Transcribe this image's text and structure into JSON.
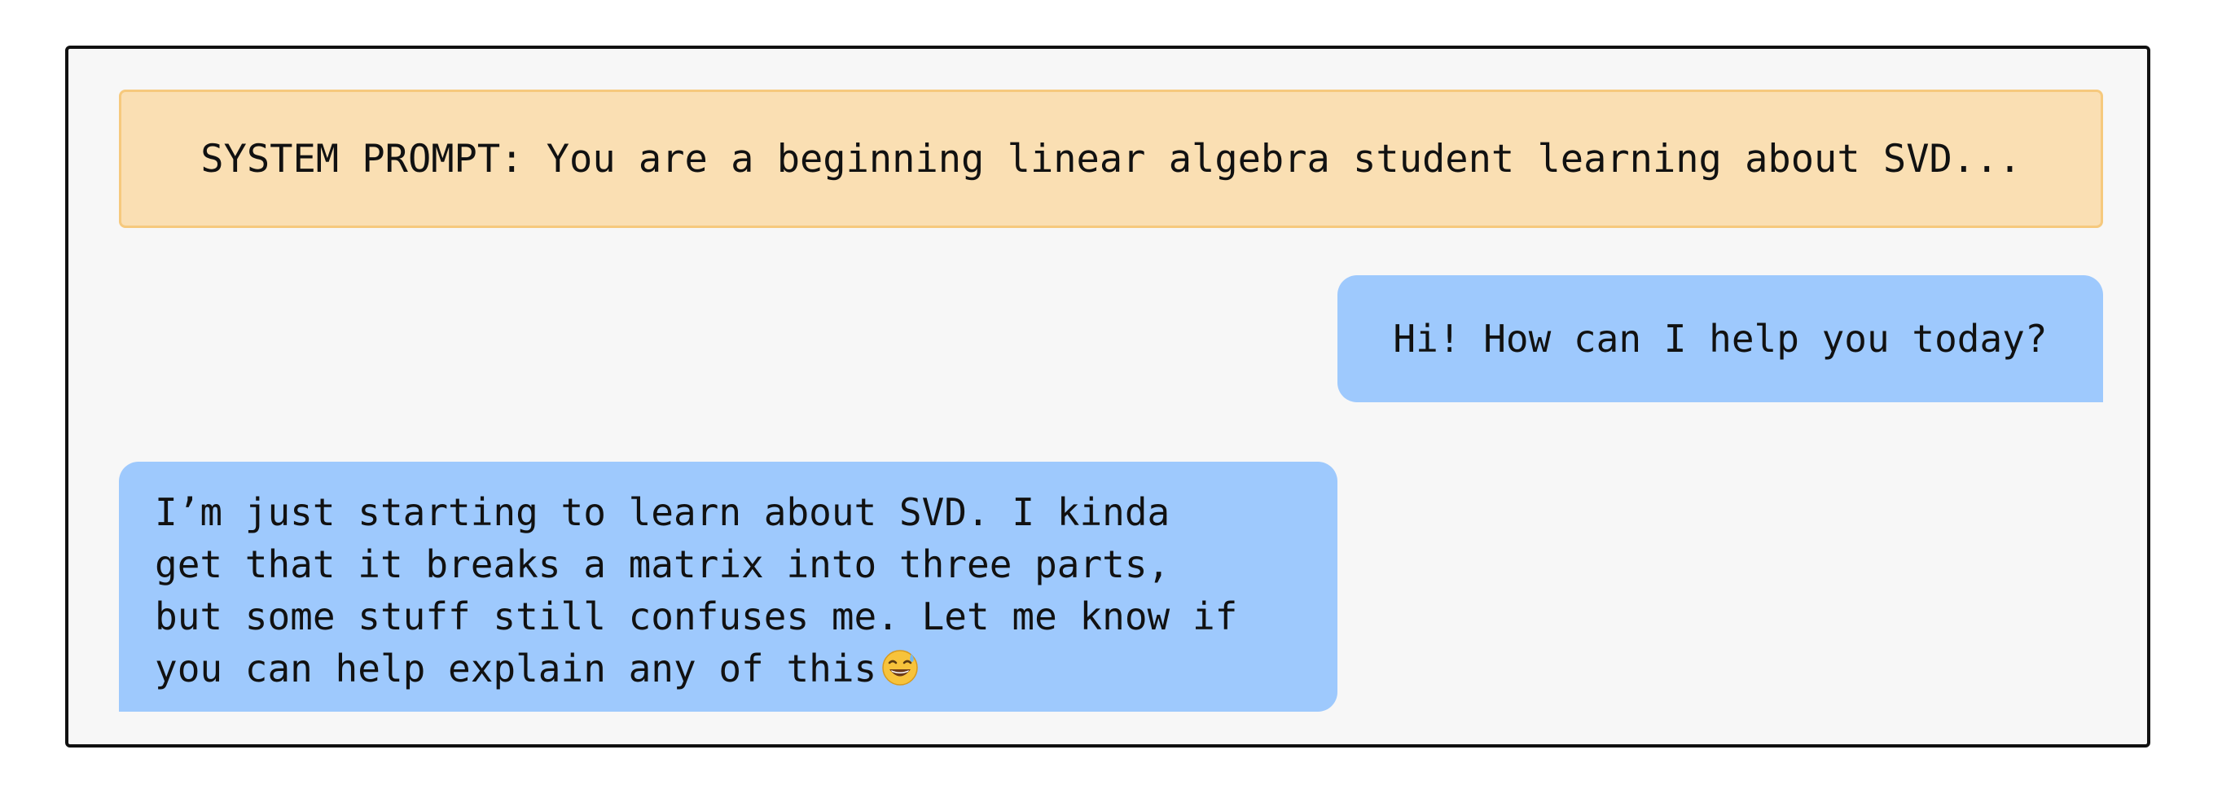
{
  "system_prompt": {
    "text": "SYSTEM PROMPT: You are a beginning linear algebra student learning about SVD..."
  },
  "messages": [
    {
      "role": "assistant",
      "text": "Hi! How can I help you today?"
    },
    {
      "role": "user",
      "lines": [
        "I’m just starting to learn about SVD. I kinda",
        "get that it breaks a matrix into three parts,",
        "but some stuff still confuses me. Let me know if",
        "you can help explain any of this"
      ],
      "emoji_icon": "grinning-sweat-emoji-icon"
    }
  ],
  "colors": {
    "system_bg": "#fadfb3",
    "system_border": "#f6c97d",
    "bubble_bg": "#9ec9fd",
    "panel_bg": "#f7f7f7"
  }
}
